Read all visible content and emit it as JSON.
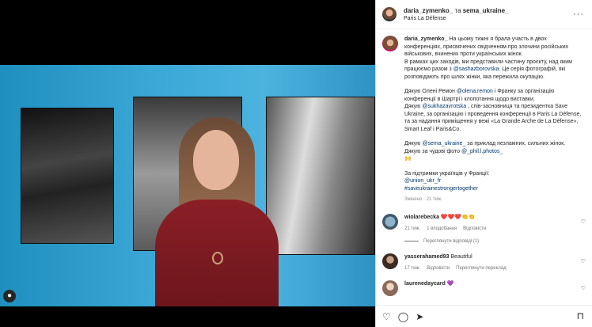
{
  "header": {
    "author": "daria_zymenko_",
    "connector": " та ",
    "coauthor": "sema_ukraine_",
    "location": "Paris La Défense",
    "more_icon": "···"
  },
  "post": {
    "username": "daria_zymenko_",
    "p1": " На цьому тижні я брала участь в двох конференціях, присвячених свідченням про злочини російських військових, вчинених проти українських жінок.",
    "p2a": "В рамках цих заходів, ми представили частину проєкту, над яким працюємо разом з ",
    "p2_mention": "@sashazborovska",
    "p2b": ". Це серія фотографій, які розповідають про шлях жінки, яка пережила окупацію.",
    "p3a": "Дякую Олені Ремон ",
    "p3_m1": "@olena.remon",
    "p3b": " і Франку за організацію конференції в Шартрі і клопотання щодо виставки.",
    "p3c": "Дякую ",
    "p3_m2": "@sukhazavrotska",
    "p3d": " , спів-засновниця та президентка Save Ukraine, за організацію і проведення конференції в Paris La Défense, та за надання приміщення у вежі «La Grande Arche de La Défense», Smart Leaf і Paris&Co.",
    "p4a": "Дякую ",
    "p4_m1": "@sema_ukraine_",
    "p4b": " за приклад незламних, сильних жінок.",
    "p4c": "Дякую за чудові фото ",
    "p4_m2": "@_phil.l.photos_",
    "p4_emoji": "🙌",
    "p5": "За підтримки українців у Франції:",
    "p5_m1": "@union_ukr_fr",
    "p5_m2": "#saveukrainestrongertogether",
    "edited": "Змінено · 21 тиж."
  },
  "comments": [
    {
      "user": "wiolarebecka",
      "text": " ❤️❤️❤️👏👏",
      "time": "21 тиж.",
      "likes": "1 вподобання",
      "reply": "Відповісти",
      "view_replies": "Переглянути відповіді (1)"
    },
    {
      "user": "yasserahamed93",
      "text": " Beautiful",
      "time": "17 тиж.",
      "reply": "Відповісти",
      "translate": "Переглянути переклад"
    },
    {
      "user": "laurenedaycard",
      "text": " 💜"
    }
  ],
  "icons": {
    "heart": "♡",
    "comment": "◯",
    "share": "➤",
    "bookmark": "⊓",
    "user_tag": "👤"
  }
}
